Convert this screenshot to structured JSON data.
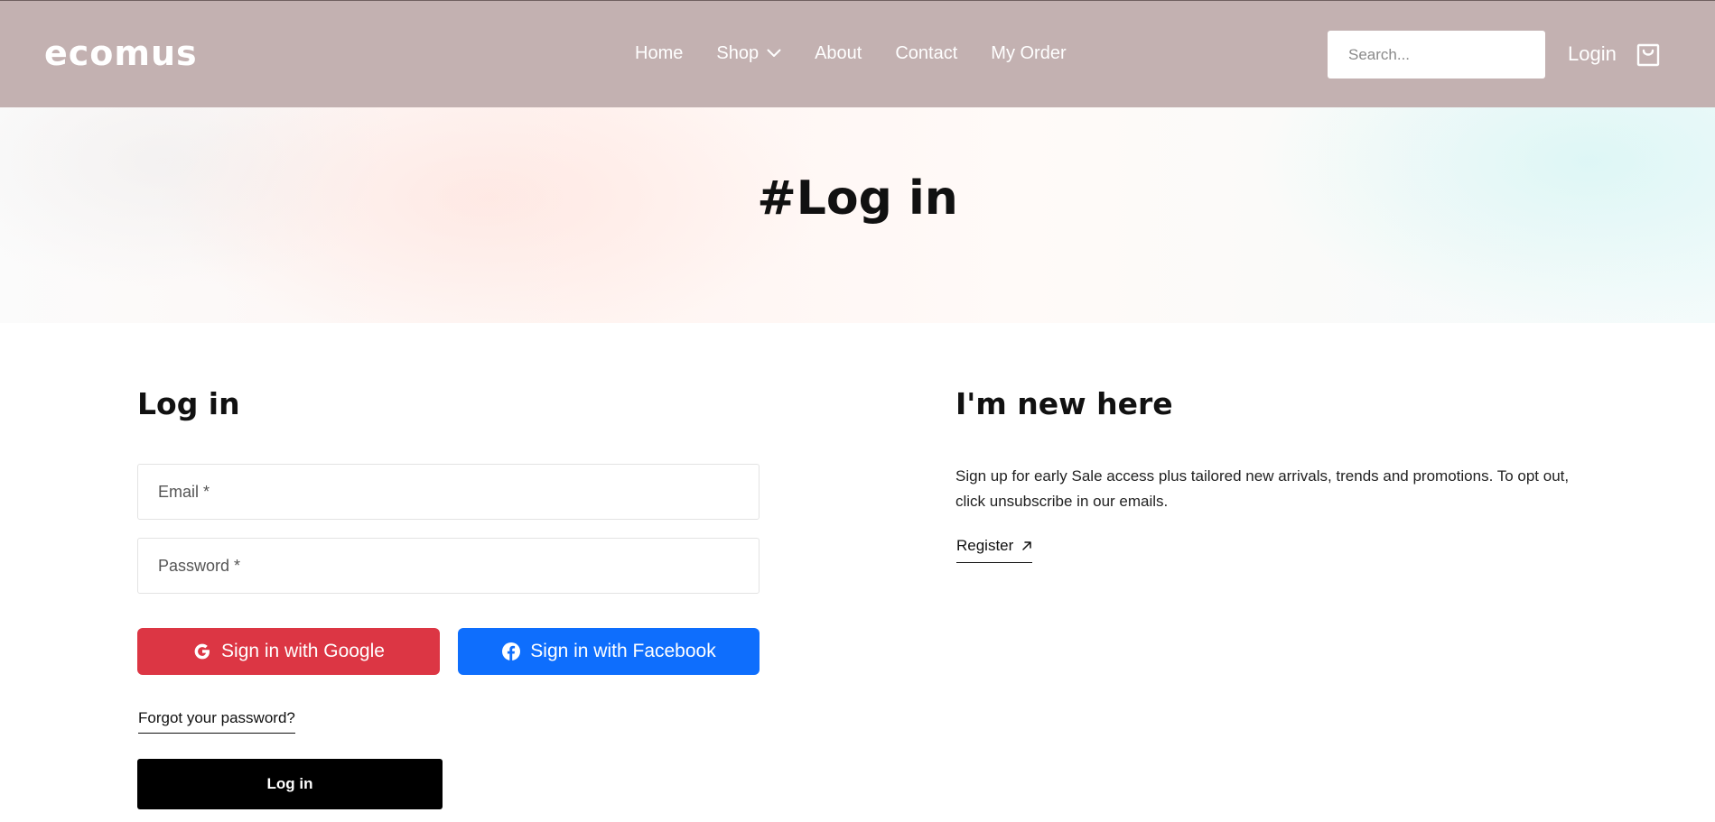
{
  "header": {
    "logo": "ecomus",
    "nav": [
      {
        "label": "Home"
      },
      {
        "label": "Shop"
      },
      {
        "label": "About"
      },
      {
        "label": "Contact"
      },
      {
        "label": "My Order"
      }
    ],
    "search_placeholder": "Search...",
    "login_label": "Login",
    "cart_icon": "shopping-bag-icon",
    "background": "#c3b1b1"
  },
  "hero": {
    "title": "#Log in"
  },
  "login": {
    "title": "Log in",
    "email_placeholder": "Email *",
    "password_placeholder": "Password *",
    "google_label": "Sign in with Google",
    "facebook_label": "Sign in with Facebook",
    "forgot_label": "Forgot your password?",
    "submit_label": "Log in",
    "colors": {
      "google": "#dc3644",
      "facebook": "#0e6efd",
      "submit": "#000000"
    }
  },
  "register": {
    "title": "I'm new here",
    "description": "Sign up for early Sale access plus tailored new arrivals, trends and promotions. To opt out, click unsubscribe in our emails.",
    "link_label": "Register",
    "link_icon": "arrow-up-right-icon"
  }
}
